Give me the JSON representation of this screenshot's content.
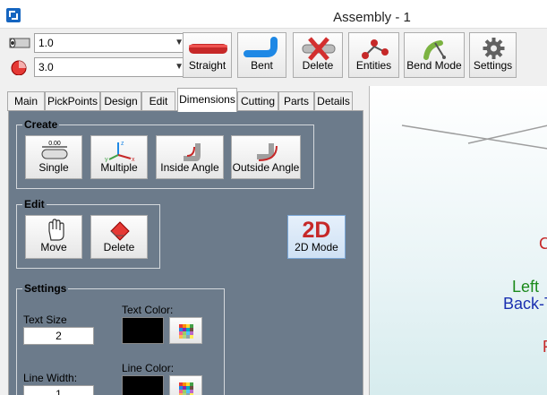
{
  "window": {
    "title": "Assembly - 1"
  },
  "toolbar": {
    "diameter_value": "1.0",
    "radius_value": "3.0",
    "buttons": [
      {
        "label": "Straight",
        "icon": "straight-tube-icon"
      },
      {
        "label": "Bent",
        "icon": "bent-tube-icon"
      },
      {
        "label": "Delete",
        "icon": "delete-tube-icon"
      },
      {
        "label": "Entities",
        "icon": "entities-icon"
      },
      {
        "label": "Bend Mode",
        "icon": "bend-mode-icon"
      },
      {
        "label": "Settings",
        "icon": "gear-icon"
      }
    ]
  },
  "tabs": [
    "Main",
    "PickPoints",
    "Design",
    "Edit",
    "Dimensions",
    "Cutting",
    "Parts",
    "Details"
  ],
  "active_tab": "Dimensions",
  "create_group": {
    "title": "Create",
    "buttons": [
      "Single",
      "Multiple",
      "Inside Angle",
      "Outside Angle"
    ],
    "single_icon_text": "0.00"
  },
  "edit_group": {
    "title": "Edit",
    "buttons": [
      "Move",
      "Delete"
    ]
  },
  "mode_button": {
    "big": "2D",
    "label": "2D Mode"
  },
  "settings_group": {
    "title": "Settings",
    "text_size_label": "Text Size",
    "text_size_value": "2",
    "text_color_label": "Text Color:",
    "line_width_label": "Line Width:",
    "line_width_value": "1",
    "line_color_label": "Line Color:"
  },
  "viewport": {
    "labels": [
      {
        "text": "C",
        "color": "#c62828"
      },
      {
        "text": "Left",
        "color": "#1b8a1b"
      },
      {
        "text": "Back-T",
        "color": "#1a2fb0"
      },
      {
        "text": "F",
        "color": "#c62828"
      }
    ]
  },
  "colors": {
    "panel": "#6c7b8b",
    "accent_red": "#c62828",
    "accent_blue": "#1e88e5"
  }
}
